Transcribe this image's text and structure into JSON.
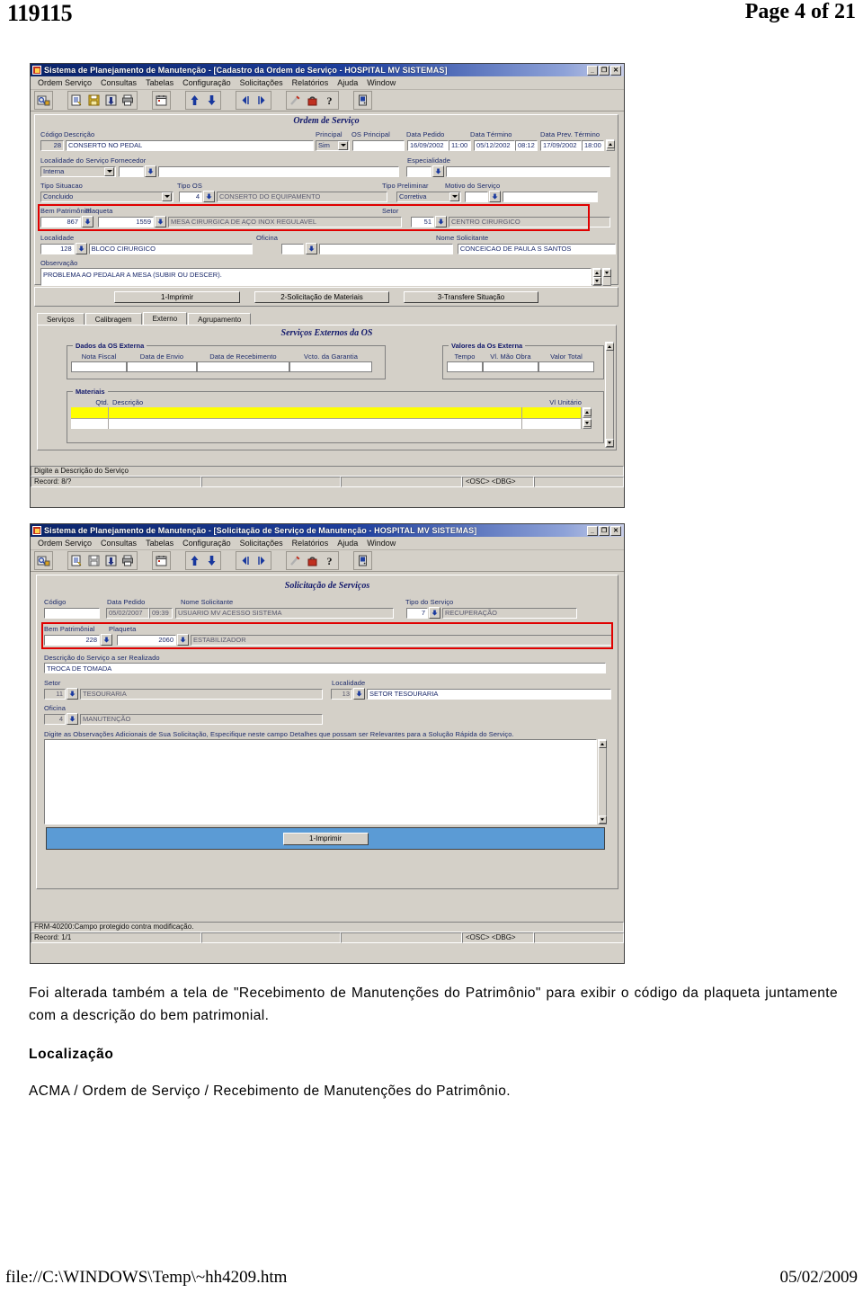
{
  "page": {
    "header_left": "119115",
    "header_right": "Page 4 of 21",
    "footer_left": "file://C:\\WINDOWS\\Temp\\~hh4209.htm",
    "footer_right": "05/02/2009"
  },
  "prose": {
    "paragraph1": "Foi alterada também a tela de \"Recebimento de Manutenções do Patrimônio\" para exibir o código da plaqueta juntamente com a descrição do bem patrimonial.",
    "localizacao_heading": "Localização",
    "localizacao_path": "ACMA / Ordem de Serviço / Recebimento de Manutenções do Patrimônio."
  },
  "window1": {
    "title": "Sistema de Planejamento de Manutenção - [Cadastro da Ordem de Serviço - HOSPITAL MV SISTEMAS]",
    "titlebar_buttons": {
      "minimize": "_",
      "restore": "❐",
      "close": "✕"
    },
    "menu": [
      "Ordem Serviço",
      "Consultas",
      "Tabelas",
      "Configuração",
      "Solicitações",
      "Relatórios",
      "Ajuda",
      "Window"
    ],
    "section_title": "Ordem de Serviço",
    "labels": {
      "codigo": "Código",
      "descricao": "Descrição",
      "principal": "Principal",
      "os_principal": "OS Principal",
      "data_pedido": "Data Pedido",
      "data_termino": "Data Término",
      "data_prev_termino": "Data Prev. Término",
      "localidade_servico": "Localidade do Serviço",
      "fornecedor": "Fornecedor",
      "especialidade": "Especialidade",
      "tipo_situacao": "Tipo Situacao",
      "tipo_os": "Tipo OS",
      "tipo_preliminar": "Tipo Preliminar",
      "motivo_servico": "Motivo do Serviço",
      "bem_patrimonial": "Bem Patrimônial",
      "plaqueta": "Plaqueta",
      "setor": "Setor",
      "localidade": "Localidade",
      "oficina": "Oficina",
      "nome_solicitante": "Nome Solicitante",
      "observacao": "Observação"
    },
    "values": {
      "codigo": "28",
      "descricao": "CONSERTO NO PEDAL",
      "principal": "Sim",
      "os_principal": "",
      "data_pedido_date": "16/09/2002",
      "data_pedido_time": "11:00",
      "data_termino_date": "05/12/2002",
      "data_termino_time": "08:12",
      "data_prev_date": "17/09/2002",
      "data_prev_time": "18:00",
      "localidade_servico": "Interna",
      "fornecedor_cod": "",
      "fornecedor_desc": "",
      "especialidade_cod": "",
      "especialidade_desc": "",
      "tipo_situacao": "Concluido",
      "tipo_os_cod": "4",
      "tipo_os_desc": "CONSERTO DO EQUIPAMENTO",
      "tipo_preliminar": "Corretiva",
      "motivo_cod": "",
      "motivo_desc": "",
      "bem_patrimonial_cod": "867",
      "plaqueta_cod": "1559",
      "plaqueta_desc": "MESA CIRURGICA DE AÇO INOX REGULAVEL",
      "setor_cod": "51",
      "setor_desc": "CENTRO CIRURGICO",
      "localidade_cod": "128",
      "localidade_desc": "BLOCO CIRURGICO",
      "oficina_cod": "",
      "oficina_desc": "",
      "nome_solicitante": "CONCEICAO DE PAULA S SANTOS",
      "observacao": "PROBLEMA AO PEDALAR A MESA (SUBIR OU DESCER)."
    },
    "buttons": {
      "imprimir": "1-Imprimir",
      "solicitacao_materiais": "2-Solicitação de Materiais",
      "transfere_situacao": "3-Transfere Situação"
    },
    "tabs": [
      {
        "label": "Serviços",
        "active": false
      },
      {
        "label": "Calibragem",
        "active": false
      },
      {
        "label": "Externo",
        "active": true
      },
      {
        "label": "Agrupamento",
        "active": false
      }
    ],
    "externo": {
      "section_title": "Serviços Externos da OS",
      "dados_caption": "Dados da OS Externa",
      "dados_headers": [
        "Nota Fiscal",
        "Data de Envio",
        "Data de Recebimento",
        "Vcto. da Garantia"
      ],
      "dados_values": [
        "",
        "",
        "",
        ""
      ],
      "valores_caption": "Valores da Os Externa",
      "valores_headers": [
        "Tempo",
        "Vl. Mão Obra",
        "Valor Total"
      ],
      "valores_values": [
        "",
        "",
        ""
      ],
      "materiais_caption": "Materiais",
      "materiais_headers": [
        "Qtd.",
        "Descrição",
        "Vl Unitário"
      ],
      "materiais_rows": [
        {
          "qtd": "",
          "descricao": "",
          "vl_unitario": "",
          "highlight": true
        },
        {
          "qtd": "",
          "descricao": "",
          "vl_unitario": "",
          "highlight": false
        }
      ]
    },
    "status": {
      "message": "Digite a Descrição do Serviço",
      "record": "Record: 8/?",
      "cell2": "",
      "cell3": "",
      "flags": "<OSC> <DBG>"
    }
  },
  "window2": {
    "title": "Sistema de Planejamento de Manutenção - [Solicitação de Serviço de Manutenção - HOSPITAL MV SISTEMAS]",
    "titlebar_buttons": {
      "minimize": "_",
      "restore": "❐",
      "close": "✕"
    },
    "menu": [
      "Ordem Serviço",
      "Consultas",
      "Tabelas",
      "Configuração",
      "Solicitações",
      "Relatórios",
      "Ajuda",
      "Window"
    ],
    "section_title": "Solicitação de Serviços",
    "labels": {
      "codigo": "Código",
      "data_pedido": "Data Pedido",
      "nome_solicitante": "Nome Solicitante",
      "tipo_servico": "Tipo do Serviço",
      "bem_patrimonial": "Bem Patrimônial",
      "plaqueta": "Plaqueta",
      "descricao_servico": "Descrição do Serviço a ser Realizado",
      "setor": "Setor",
      "localidade": "Localidade",
      "oficina": "Oficina",
      "observacoes": "Digite as Observações Adicionais de Sua Solicitação, Especifique neste campo Detalhes que possam ser Relevantes para a Solução Rápida do Serviço."
    },
    "values": {
      "codigo": "",
      "data_pedido_date": "05/02/2007",
      "data_pedido_time": "09:39",
      "nome_solicitante": "USUARIO MV ACESSO SISTEMA",
      "tipo_servico_cod": "7",
      "tipo_servico_desc": "RECUPERAÇÃO",
      "bem_patrimonial_cod": "228",
      "plaqueta_cod": "2060",
      "plaqueta_desc": "ESTABILIZADOR",
      "descricao_servico": "TROCA DE TOMADA",
      "setor_cod": "11",
      "setor_desc": "TESOURARIA",
      "localidade_cod": "13",
      "localidade_desc": "SETOR TESOURARIA",
      "oficina_cod": "4",
      "oficina_desc": "MANUTENÇÃO",
      "observacoes": ""
    },
    "buttons": {
      "imprimir": "1-Imprimir"
    },
    "status": {
      "message": "FRM-40200:Campo protegido contra modificação.",
      "record": "Record: 1/1",
      "cell2": "",
      "cell3": "",
      "flags": "<OSC> <DBG>"
    }
  },
  "colors": {
    "titlebar_start": "#0a246a",
    "face": "#d4d0c8",
    "label_blue": "#1b2a6b",
    "red_highlight": "#e00000",
    "yellow_row": "#ffff00",
    "blue_panel": "#5b9bd5"
  }
}
